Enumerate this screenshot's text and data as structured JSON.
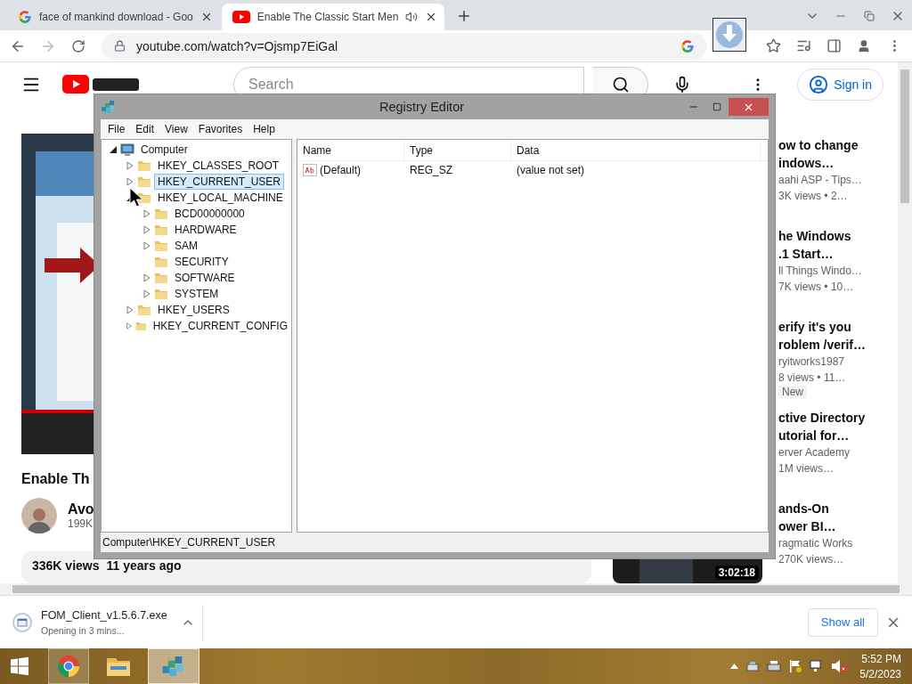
{
  "browser": {
    "tabs": [
      {
        "title": "face of mankind download - Goo",
        "kind": "google",
        "selected": false,
        "audio": false
      },
      {
        "title": "Enable The Classic Start Men",
        "kind": "youtube",
        "selected": true,
        "audio": true
      }
    ],
    "url": "youtube.com/watch?v=Ojsmp7EiGal"
  },
  "youtube": {
    "search_placeholder": "Search",
    "sign_in": "Sign in",
    "video": {
      "title": "Enable Th",
      "channel": "Avo",
      "subscribers": "199K",
      "views": "336K views",
      "age": "11 years ago"
    },
    "recommendations": [
      {
        "title_lines": [
          "ow to change",
          "indows…"
        ],
        "channel": "aahi ASP - Tips…",
        "meta": "3K views • 2…"
      },
      {
        "title_lines": [
          "he Windows",
          ".1 Start…"
        ],
        "channel": "ll Things Windo…",
        "meta": "7K views • 10…"
      },
      {
        "title_lines": [
          "erify it's you",
          "roblem /verif…"
        ],
        "channel": "ryitworks1987",
        "meta": "8 views • 11…",
        "badge": "New"
      },
      {
        "title_lines": [
          "ctive Directory",
          "utorial for…"
        ],
        "channel": "erver Academy",
        "meta": "1M views…"
      },
      {
        "title_lines": [
          "ands-On",
          "ower BI…"
        ],
        "channel": "ragmatic Works",
        "meta": "270K views…",
        "duration": "3:02:18"
      }
    ]
  },
  "regedit": {
    "title": "Registry Editor",
    "menu": [
      "File",
      "Edit",
      "View",
      "Favorites",
      "Help"
    ],
    "tree": [
      {
        "label": "Computer",
        "kind": "computer",
        "expandable": true,
        "expanded": true,
        "selected": false,
        "children": [
          {
            "label": "HKEY_CLASSES_ROOT",
            "kind": "folder",
            "expandable": true,
            "expanded": false,
            "selected": false
          },
          {
            "label": "HKEY_CURRENT_USER",
            "kind": "folder",
            "expandable": true,
            "expanded": false,
            "selected": true
          },
          {
            "label": "HKEY_LOCAL_MACHINE",
            "kind": "folder",
            "expandable": true,
            "expanded": true,
            "selected": false,
            "children": [
              {
                "label": "BCD00000000",
                "kind": "folder",
                "expandable": true,
                "expanded": false,
                "selected": false
              },
              {
                "label": "HARDWARE",
                "kind": "folder",
                "expandable": true,
                "expanded": false,
                "selected": false
              },
              {
                "label": "SAM",
                "kind": "folder",
                "expandable": true,
                "expanded": false,
                "selected": false
              },
              {
                "label": "SECURITY",
                "kind": "folder",
                "expandable": false,
                "selected": false
              },
              {
                "label": "SOFTWARE",
                "kind": "folder",
                "expandable": true,
                "expanded": false,
                "selected": false
              },
              {
                "label": "SYSTEM",
                "kind": "folder",
                "expandable": true,
                "expanded": false,
                "selected": false
              }
            ]
          },
          {
            "label": "HKEY_USERS",
            "kind": "folder",
            "expandable": true,
            "expanded": false,
            "selected": false
          },
          {
            "label": "HKEY_CURRENT_CONFIG",
            "kind": "folder",
            "expandable": true,
            "expanded": false,
            "selected": false
          }
        ]
      }
    ],
    "columns": [
      "Name",
      "Type",
      "Data"
    ],
    "values": [
      {
        "name": "(Default)",
        "type": "REG_SZ",
        "data": "(value not set)"
      }
    ],
    "status": "Computer\\HKEY_CURRENT_USER"
  },
  "download": {
    "filename": "FOM_Client_v1.5.6.7.exe",
    "status": "Opening in 3 mins...",
    "show_all": "Show all"
  },
  "taskbar": {
    "apps": [
      {
        "kind": "chrome",
        "running": true,
        "selected": false
      },
      {
        "kind": "explorer",
        "running": false,
        "selected": false
      },
      {
        "kind": "regedit",
        "running": true,
        "selected": true
      }
    ],
    "time": "5:52 PM",
    "date": "5/2/2023"
  }
}
